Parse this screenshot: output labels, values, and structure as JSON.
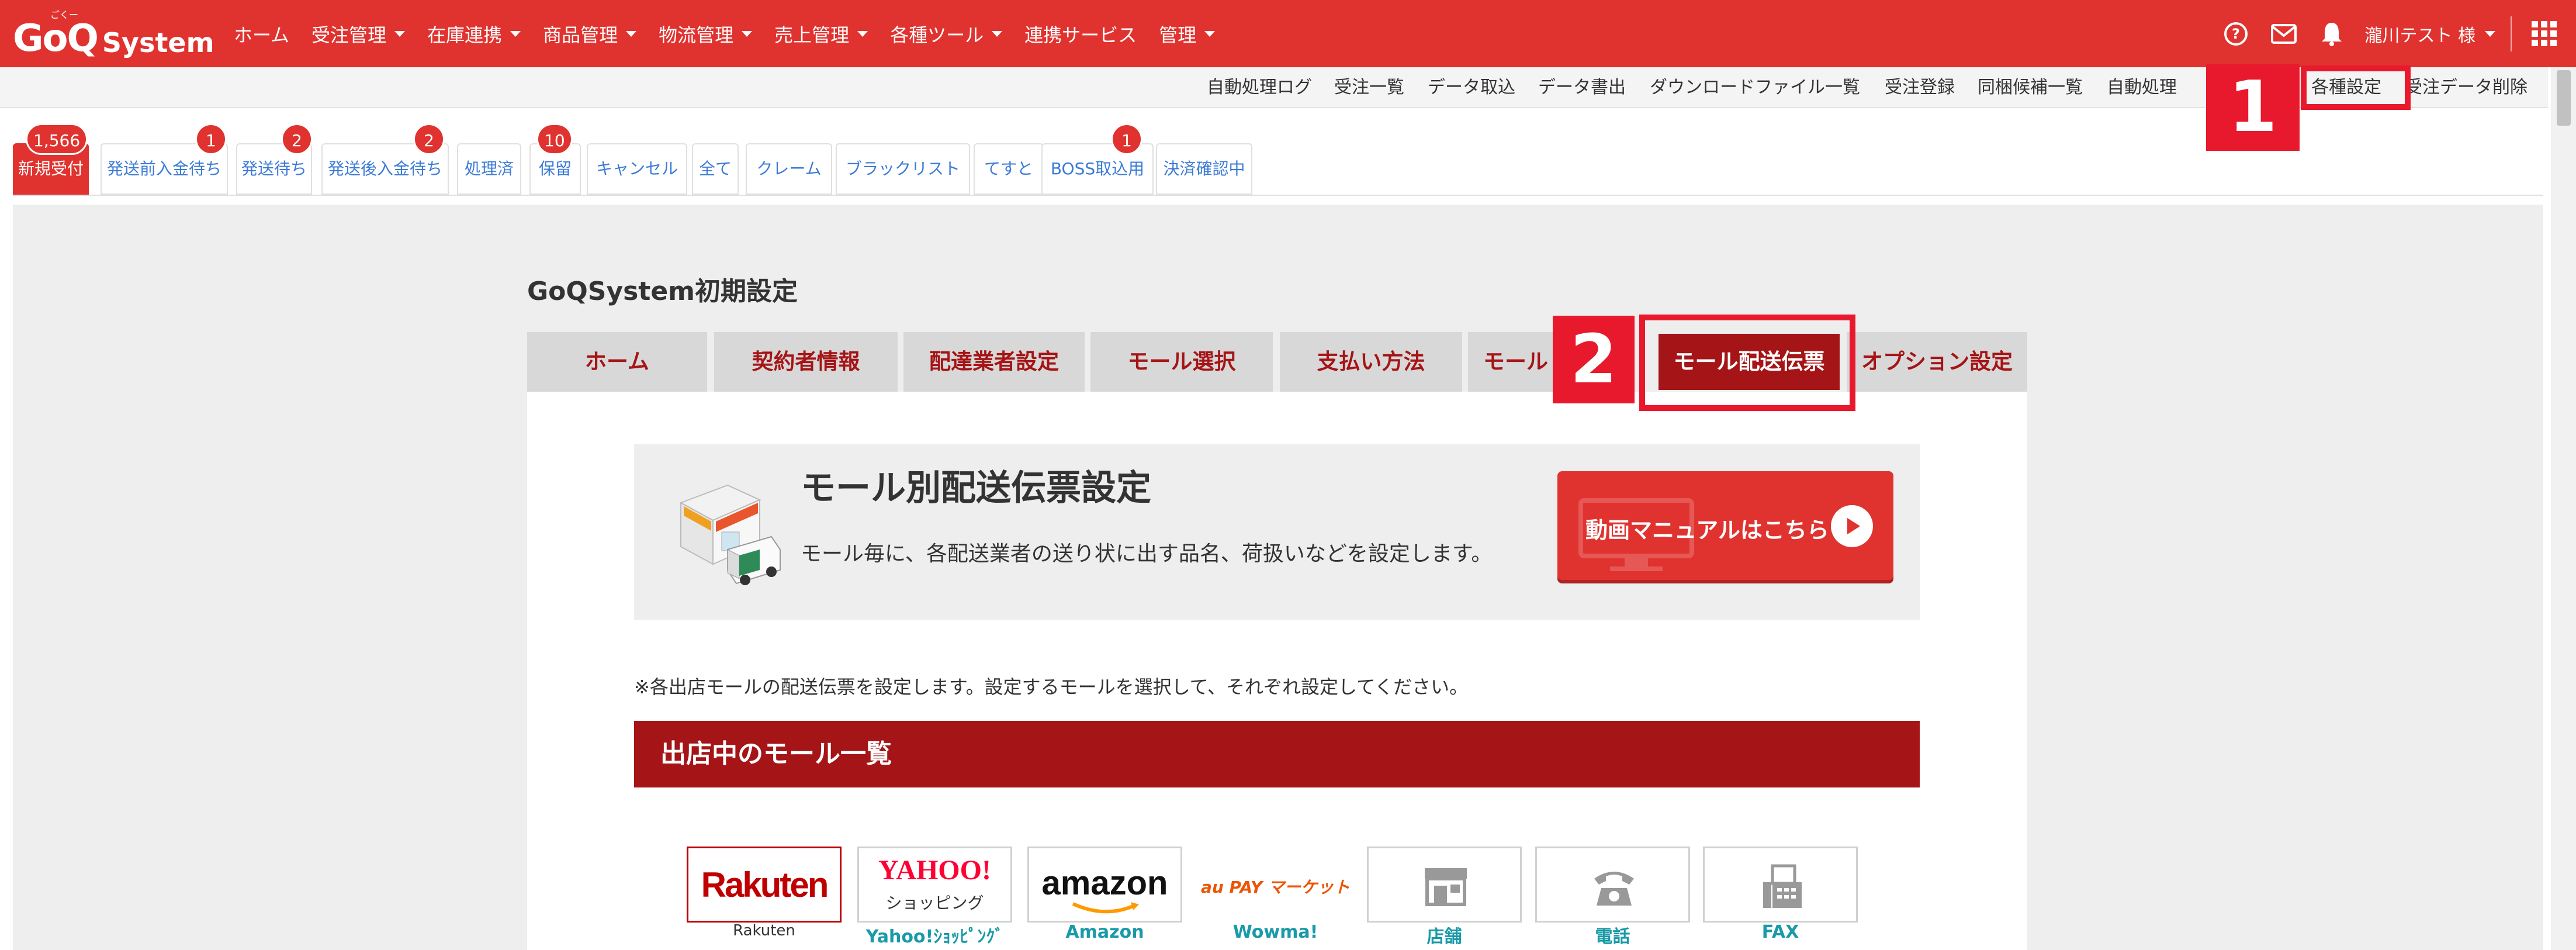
{
  "logo": {
    "brand": "GoQ",
    "suffix": "System",
    "ruby": "ごくー"
  },
  "main_menu": [
    {
      "label": "ホーム",
      "dropdown": false
    },
    {
      "label": "受注管理",
      "dropdown": true
    },
    {
      "label": "在庫連携",
      "dropdown": true
    },
    {
      "label": "商品管理",
      "dropdown": true
    },
    {
      "label": "物流管理",
      "dropdown": true
    },
    {
      "label": "売上管理",
      "dropdown": true
    },
    {
      "label": "各種ツール",
      "dropdown": true
    },
    {
      "label": "連携サービス",
      "dropdown": false
    },
    {
      "label": "管理",
      "dropdown": true
    }
  ],
  "right_nav": {
    "user_name": "瀧川テスト 様",
    "icons": [
      "help-icon",
      "mail-icon",
      "bell-icon",
      "apps-grid-icon"
    ]
  },
  "sub_nav": [
    "自動処理ログ",
    "受注一覧",
    "データ取込",
    "データ書出",
    "ダウンロードファイル一覧",
    "受注登録",
    "同梱候補一覧",
    "自動処理",
    "各種設定",
    "受注データ削除"
  ],
  "status_tabs": [
    {
      "label": "新規受付",
      "badge": "1,566",
      "active": true
    },
    {
      "label": "発送前入金待ち",
      "badge": "1"
    },
    {
      "label": "発送待ち",
      "badge": "2"
    },
    {
      "label": "発送後入金待ち",
      "badge": "2"
    },
    {
      "label": "処理済",
      "badge": ""
    },
    {
      "label": "保留",
      "badge": "10"
    },
    {
      "label": "キャンセル",
      "badge": ""
    },
    {
      "label": "全て",
      "badge": ""
    },
    {
      "label": "クレーム",
      "badge": ""
    },
    {
      "label": "ブラックリスト",
      "badge": ""
    },
    {
      "label": "てすと",
      "badge": ""
    },
    {
      "label": "BOSS取込用",
      "badge": "1"
    },
    {
      "label": "決済確認中",
      "badge": ""
    }
  ],
  "page_title": "GoQSystem初期設定",
  "settings_tabs": [
    {
      "label": "ホーム"
    },
    {
      "label": "契約者情報"
    },
    {
      "label": "配達業者設定"
    },
    {
      "label": "モール選択"
    },
    {
      "label": "支払い方法"
    },
    {
      "label": "モール"
    },
    {
      "label": "モール配送伝票",
      "active": true
    },
    {
      "label": "オプション設定"
    }
  ],
  "banner": {
    "title": "モール別配送伝票設定",
    "description": "モール毎に、各配送業者の送り状に出す品名、荷扱いなどを設定します。",
    "manual_button": "動画マニュアルはこちら"
  },
  "note": "※各出店モールの配送伝票を設定します。設定するモールを選択して、それぞれ設定してください。",
  "mall_list_header": "出店中のモール一覧",
  "malls": [
    {
      "label": "Rakuten",
      "logo_text": "Rakuten",
      "color": "#bf0000"
    },
    {
      "label": "Yahoo!ｼｮｯﾋﾟﾝｸﾞ",
      "logo_text": "YAHOO!",
      "logo_sub": "ショッピング",
      "color": "#ff0033"
    },
    {
      "label": "Amazon",
      "logo_text": "amazon",
      "color": "#111111"
    },
    {
      "label": "Wowma!",
      "logo_text": "au PAY マーケット",
      "color": "#eb5505"
    },
    {
      "label": "店舗",
      "icon": "store-icon"
    },
    {
      "label": "電話",
      "icon": "phone-icon"
    },
    {
      "label": "FAX",
      "icon": "fax-icon"
    }
  ],
  "callouts": [
    "1",
    "2"
  ],
  "colors": {
    "brand_red": "#e0332f",
    "dark_red": "#a51416",
    "link_blue": "#3d7bd6",
    "mall_label": "#1a9aa8",
    "callout": "#e8192c"
  }
}
